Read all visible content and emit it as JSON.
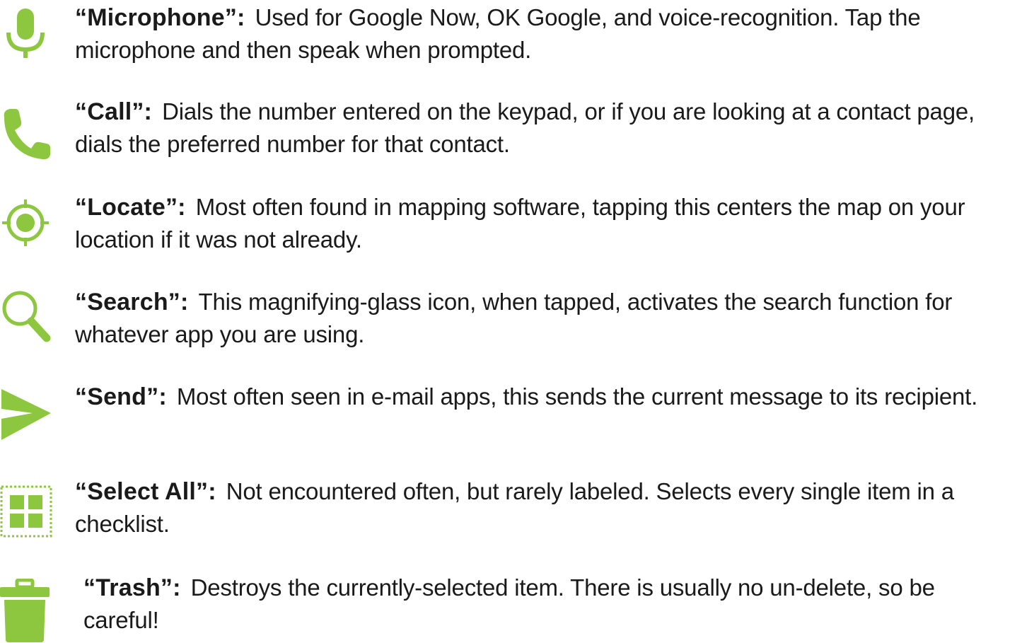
{
  "colors": {
    "icon_green": "#8dc63f",
    "text": "#1a1a1a"
  },
  "entries": [
    {
      "icon": "microphone-icon",
      "term": "“Microphone”:",
      "description": "Used for Google Now, OK Google, and voice-recognition.  Tap the microphone and then speak when prompted."
    },
    {
      "icon": "phone-icon",
      "term": "“Call”:",
      "description": "Dials the number entered on the keypad, or if you are looking at a contact page, dials the preferred number for that contact."
    },
    {
      "icon": "locate-icon",
      "term": "“Locate”:",
      "description": "Most often found in mapping software, tapping this centers the map on your location if it was not already."
    },
    {
      "icon": "search-icon",
      "term": "“Search”:",
      "description": "This magnifying-glass icon, when tapped, activates the search function for whatever app you are using."
    },
    {
      "icon": "send-icon",
      "term": "“Send”:",
      "description": "Most often seen in e-mail apps, this sends the current message to its recipient."
    },
    {
      "icon": "select-all-icon",
      "term": "“Select All”:",
      "description": "Not encountered often, but rarely labeled.  Selects every single item in a checklist."
    },
    {
      "icon": "trash-icon",
      "term": "“Trash”:",
      "description": "Destroys the currently-selected item.  There is usually no un-delete, so be careful!"
    }
  ]
}
